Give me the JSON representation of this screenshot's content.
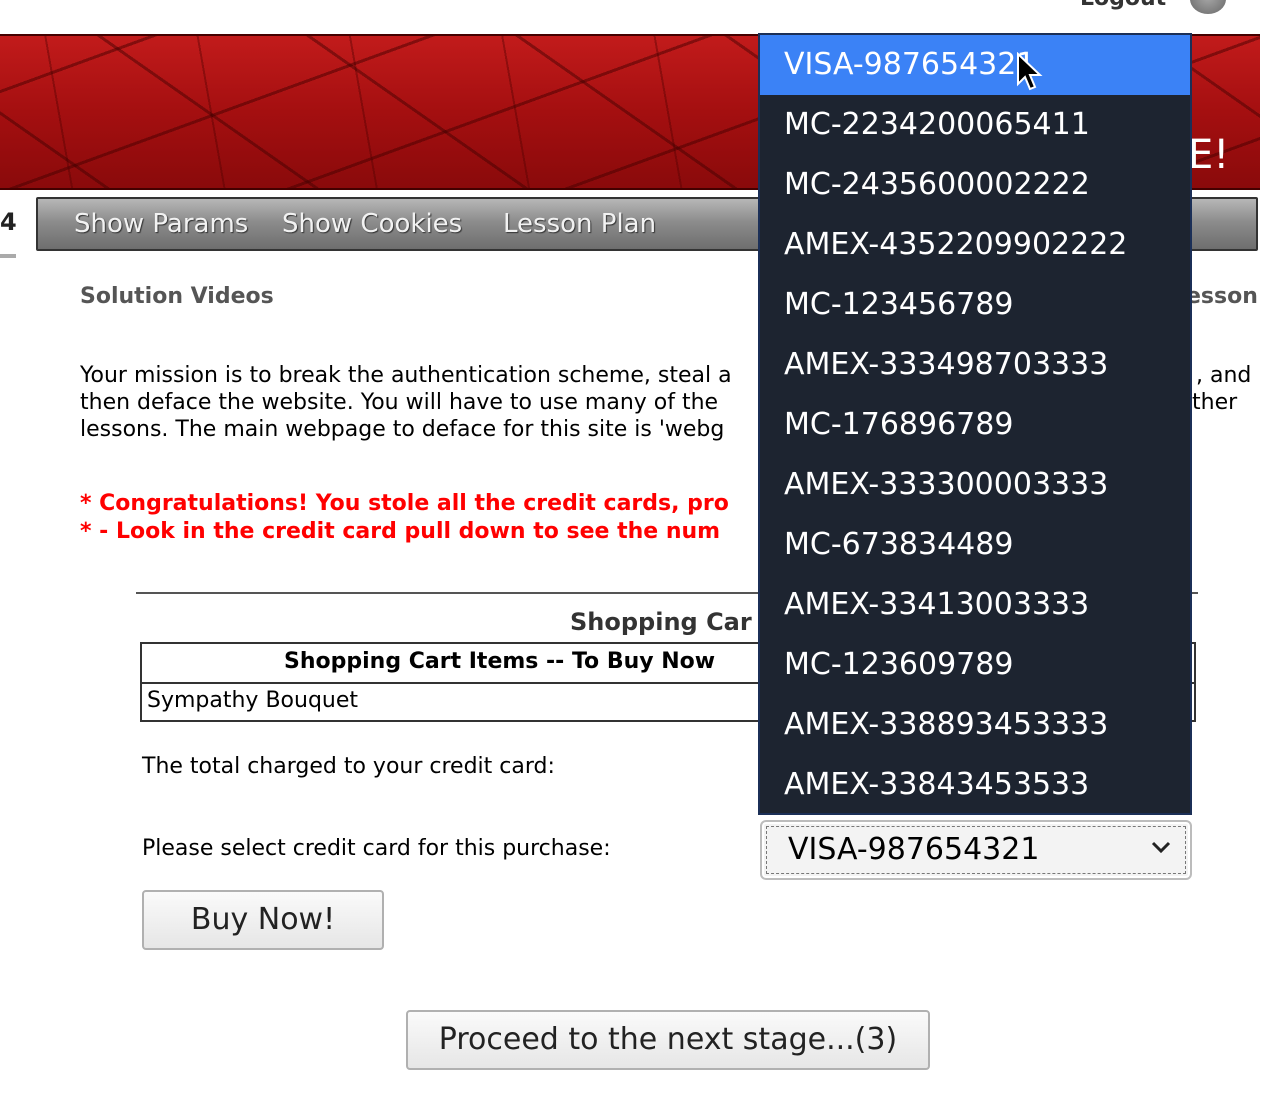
{
  "header": {
    "logout_label": "Logout"
  },
  "banner": {
    "text": "E!"
  },
  "nav": {
    "lesson_fragment": "4",
    "links": [
      "Show Params",
      "Show Cookies",
      "Lesson Plan"
    ]
  },
  "content": {
    "solution_videos": "Solution Videos",
    "restart_lesson": "esson",
    "mission_lines": [
      "Your mission is to break the authentication scheme, steal a",
      "then deface the website. You will have to use many of the",
      "lessons. The main webpage to deface for this site is 'webg"
    ],
    "mission_right": [
      ", and",
      "ther",
      ""
    ],
    "congrats_lines": [
      "* Congratulations! You stole all the credit cards, pro",
      "* - Look in the credit card pull down to see the num"
    ]
  },
  "cart": {
    "title": "Shopping Car",
    "header": "Shopping Cart Items -- To Buy Now",
    "item": "Sympathy Bouquet",
    "total_label": "The total charged to your credit card:",
    "select_label": "Please select credit card for this purchase:",
    "selected_card": "VISA-987654321"
  },
  "dropdown": {
    "options": [
      "VISA-987654321",
      "MC-2234200065411",
      "MC-2435600002222",
      "AMEX-4352209902222",
      "MC-123456789",
      "AMEX-333498703333",
      "MC-176896789",
      "AMEX-333300003333",
      "MC-673834489",
      "AMEX-33413003333",
      "MC-123609789",
      "AMEX-338893453333",
      "AMEX-33843453533"
    ],
    "highlighted_index": 0
  },
  "buttons": {
    "buy_now": "Buy Now!",
    "proceed": "Proceed to the next stage...(3)"
  },
  "colors": {
    "banner_red": "#b5151a",
    "dropdown_bg": "#1d2430",
    "highlight_blue": "#3b82f6",
    "alert_red": "#ff0000"
  }
}
